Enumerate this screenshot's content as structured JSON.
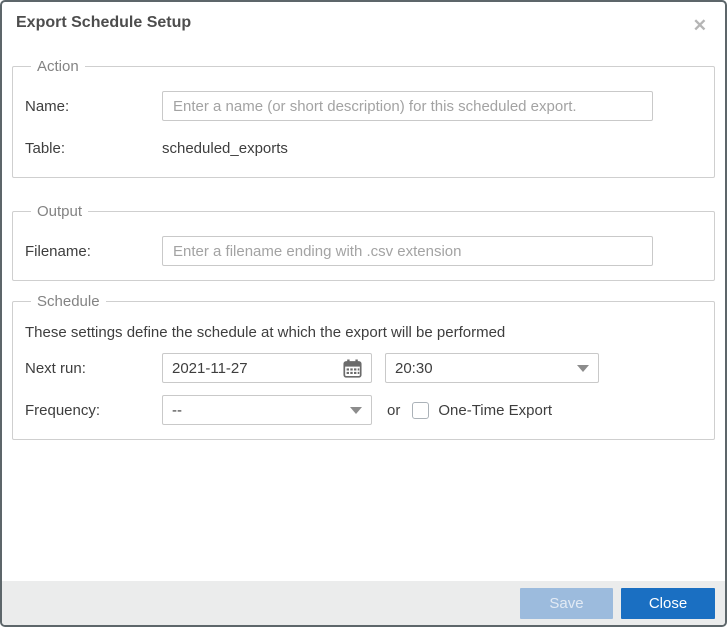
{
  "dialog": {
    "title": "Export Schedule Setup",
    "close_icon": "✕"
  },
  "action": {
    "legend": "Action",
    "name_label": "Name:",
    "name_value": "",
    "name_placeholder": "Enter a name (or short description) for this scheduled export.",
    "table_label": "Table:",
    "table_value": "scheduled_exports"
  },
  "output": {
    "legend": "Output",
    "filename_label": "Filename:",
    "filename_value": "",
    "filename_placeholder": "Enter a filename ending with .csv extension"
  },
  "schedule": {
    "legend": "Schedule",
    "description": "These settings define the schedule at which the export will be performed",
    "next_run_label": "Next run:",
    "next_run_date": "2021-11-27",
    "next_run_time": "20:30",
    "frequency_label": "Frequency:",
    "frequency_value": "--",
    "or_label": "or",
    "one_time_label": "One-Time Export",
    "one_time_checked": false
  },
  "footer": {
    "save_label": "Save",
    "close_label": "Close"
  },
  "colors": {
    "close_button": "#1a6fc2",
    "save_button": "#9cbbdd",
    "footer_bg": "#ebecec",
    "legend_text": "#838383",
    "dialog_border": "#5d666a"
  },
  "icons": {
    "close": "close-icon",
    "calendar": "calendar-icon",
    "dropdown_arrows": "chevron-down-icon"
  }
}
